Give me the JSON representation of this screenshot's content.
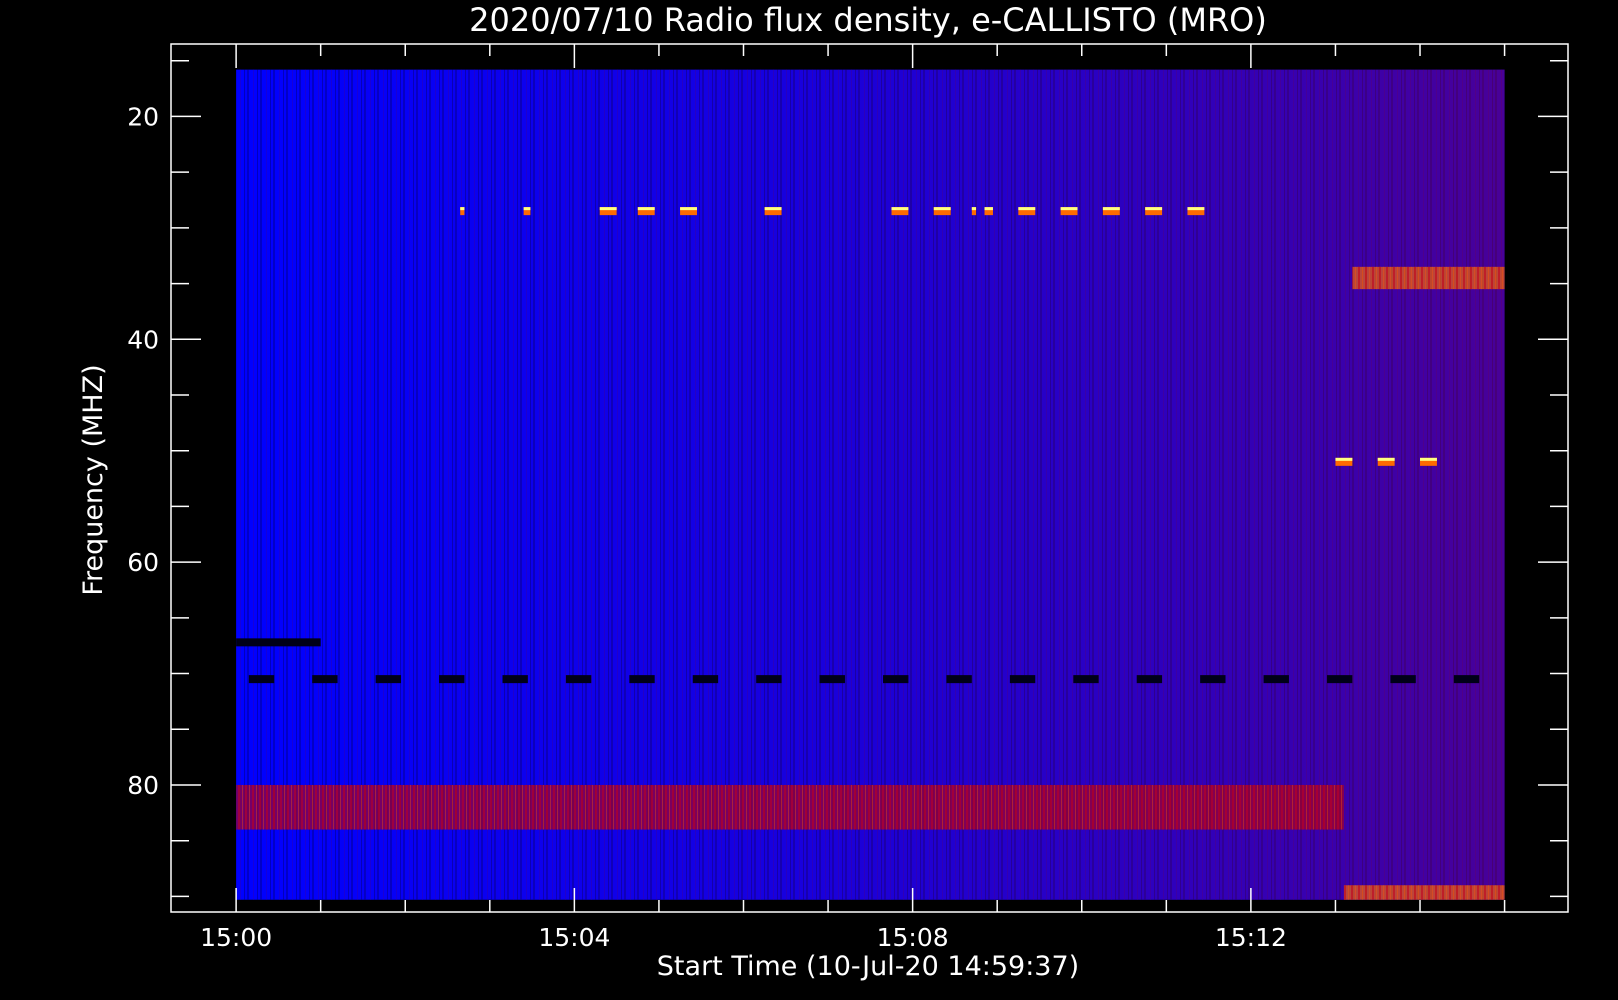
{
  "chart_data": {
    "type": "heatmap",
    "title": "2020/07/10  Radio flux density, e-CALLISTO (MRO)",
    "xlabel": "Start Time (10-Jul-20 14:59:37)",
    "ylabel": "Frequency (MHZ)",
    "x_unit": "minutes after 15:00",
    "y_unit": "MHz",
    "xlim": [
      -0.77,
      15.75
    ],
    "ylim": [
      91.4,
      13.5
    ],
    "y_inverted": true,
    "data_xrange": [
      0,
      15.0
    ],
    "data_yrange": [
      15.8,
      90.3
    ],
    "x_ticks": [
      {
        "value": 0,
        "label": "15:00"
      },
      {
        "value": 4,
        "label": "15:04"
      },
      {
        "value": 8,
        "label": "15:08"
      },
      {
        "value": 12,
        "label": "15:12"
      }
    ],
    "x_minor_step": 1,
    "y_ticks": [
      {
        "value": 20,
        "label": "20"
      },
      {
        "value": 40,
        "label": "40"
      },
      {
        "value": 60,
        "label": "60"
      },
      {
        "value": 80,
        "label": "80"
      }
    ],
    "y_minor_step": 5,
    "colors": {
      "background": "#000000",
      "low": "#0000ff",
      "mid": "#b0001a",
      "high": "#ff6a00",
      "peak": "#ffff80",
      "axis": "#ffffff"
    },
    "features": [
      {
        "name": "interference-28.5MHz",
        "y": 28.5,
        "x_starts": [
          2.65,
          3.4,
          4.3,
          4.75,
          5.25,
          6.25,
          7.75,
          8.25,
          8.7,
          8.85,
          9.25,
          9.75,
          10.25,
          10.75,
          11.25
        ],
        "x_widths": [
          0.05,
          0.08,
          0.2,
          0.2,
          0.2,
          0.2,
          0.2,
          0.2,
          0.05,
          0.1,
          0.2,
          0.2,
          0.2,
          0.2,
          0.2
        ],
        "level": "high"
      },
      {
        "name": "interference-51MHz",
        "y": 51,
        "x_starts": [
          13.0,
          13.5,
          14.0
        ],
        "x_widths": [
          0.2,
          0.2,
          0.2
        ],
        "level": "high"
      },
      {
        "name": "dropouts-70.5MHz",
        "y": 70.5,
        "x_starts": [
          0.15,
          0.9,
          1.65,
          2.4,
          3.15,
          3.9,
          4.65,
          5.4,
          6.15,
          6.9,
          7.65,
          8.4,
          9.15,
          9.9,
          10.65,
          11.4,
          12.15,
          12.9,
          13.65,
          14.4
        ],
        "x_width": 0.3,
        "level": "dark"
      },
      {
        "name": "dark-line-67MHz",
        "y": 67.2,
        "x_start": 0,
        "x_end": 1.0,
        "level": "dark"
      },
      {
        "name": "emission-band-33-35MHz",
        "y_range": [
          33.5,
          35.5
        ],
        "x_range": [
          13.2,
          15.0
        ],
        "level": "high"
      },
      {
        "name": "emission-band-80-84MHz",
        "y_range": [
          80,
          84
        ],
        "x_range": [
          0,
          13.1
        ],
        "level": "mid"
      },
      {
        "name": "bright-band-89-90MHz",
        "y_range": [
          89,
          90.3
        ],
        "x_range": [
          13.1,
          15.0
        ],
        "level": "high"
      }
    ]
  }
}
